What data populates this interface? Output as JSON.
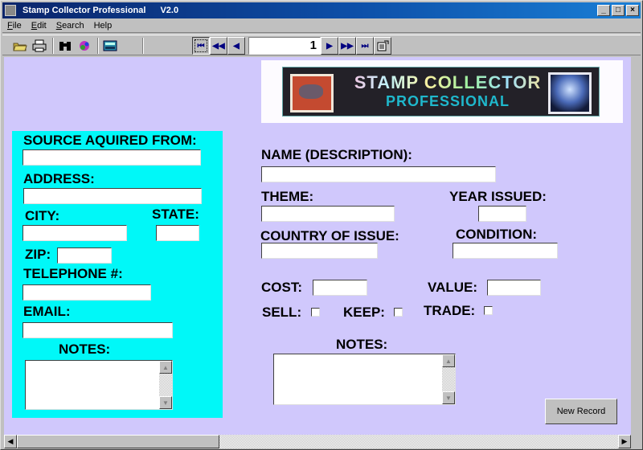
{
  "window": {
    "title": "Stamp Collector Professional",
    "version": "V2.0",
    "minimize": "_",
    "maximize": "□",
    "close": "×"
  },
  "menu": [
    {
      "label": "File",
      "accel": "F",
      "rest": "ile"
    },
    {
      "label": "Edit",
      "accel": "E",
      "rest": "dit"
    },
    {
      "label": "Search",
      "accel": "S",
      "rest": "earch"
    },
    {
      "label": "Help",
      "accel": "",
      "rest": "Help"
    }
  ],
  "toolbar": {
    "icons": [
      "open-folder-icon",
      "print-icon",
      "binoculars-find-icon",
      "color-palette-icon",
      "calculator-icon"
    ],
    "nav": {
      "first": "⏮",
      "prev_page": "◀◀",
      "prev": "◀",
      "record": "1",
      "next": "▶",
      "next_page": "▶▶",
      "last": "⏭"
    }
  },
  "logo": {
    "line1": "STAMP  COLLECTOR",
    "line2": "PROFESSIONAL"
  },
  "source_panel": {
    "source": {
      "label": "SOURCE AQUIRED FROM:",
      "value": ""
    },
    "address": {
      "label": "ADDRESS:",
      "value": ""
    },
    "city": {
      "label": "CITY:",
      "value": ""
    },
    "state": {
      "label": "STATE:",
      "value": ""
    },
    "zip": {
      "label": "ZIP:",
      "value": ""
    },
    "telephone": {
      "label": "TELEPHONE #:",
      "value": ""
    },
    "email": {
      "label": "EMAIL:",
      "value": ""
    },
    "notes": {
      "label": "NOTES:",
      "value": ""
    }
  },
  "stamp": {
    "name": {
      "label": "NAME (DESCRIPTION):",
      "value": ""
    },
    "theme": {
      "label": "THEME:",
      "value": ""
    },
    "year": {
      "label": "YEAR ISSUED:",
      "value": ""
    },
    "country": {
      "label": "COUNTRY OF ISSUE:",
      "value": ""
    },
    "condition": {
      "label": "CONDITION:",
      "value": ""
    },
    "cost": {
      "label": "COST:",
      "value": ""
    },
    "value": {
      "label": "VALUE:",
      "value": ""
    },
    "sell": {
      "label": "SELL:",
      "checked": false
    },
    "keep": {
      "label": "KEEP:",
      "checked": false
    },
    "trade": {
      "label": "TRADE:",
      "checked": false
    },
    "notes": {
      "label": "NOTES:",
      "value": ""
    }
  },
  "buttons": {
    "new_record": "New Record"
  },
  "colors": {
    "background": "#d0c8fc",
    "panel": "#00f8f8",
    "titlebar": "#0a246a"
  }
}
